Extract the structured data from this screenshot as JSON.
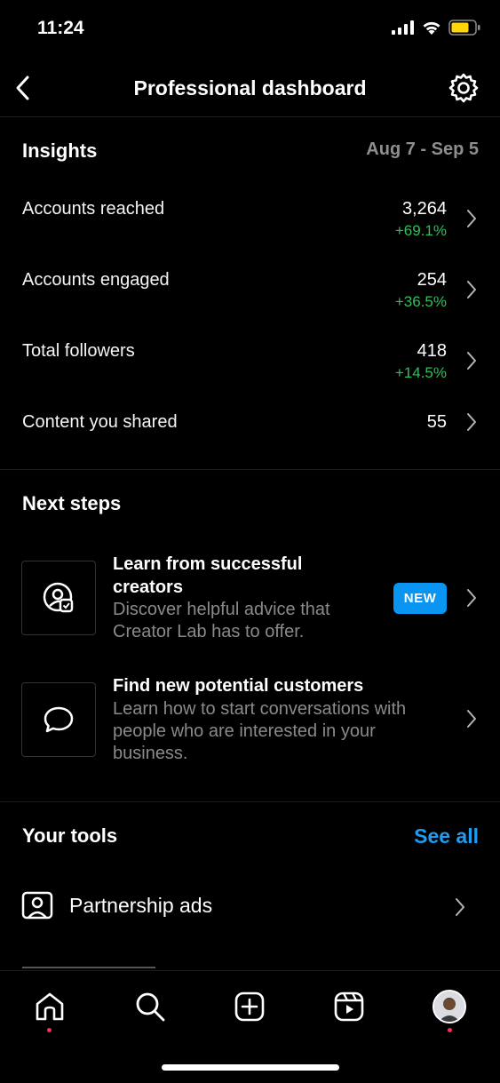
{
  "status_bar": {
    "time": "11:24"
  },
  "header": {
    "title": "Professional dashboard"
  },
  "insights": {
    "title": "Insights",
    "date_range": "Aug 7 - Sep 5",
    "rows": [
      {
        "label": "Accounts reached",
        "value": "3,264",
        "change": "+69.1%"
      },
      {
        "label": "Accounts engaged",
        "value": "254",
        "change": "+36.5%"
      },
      {
        "label": "Total followers",
        "value": "418",
        "change": "+14.5%"
      },
      {
        "label": "Content you shared",
        "value": "55",
        "change": ""
      }
    ]
  },
  "next_steps": {
    "title": "Next steps",
    "items": [
      {
        "title_line1": "Learn from successful",
        "title_line2": "creators",
        "desc_line1": "Discover helpful advice that",
        "desc_line2": "Creator Lab has to offer.",
        "badge": "NEW",
        "icon": "creator-lab-icon"
      },
      {
        "title_line1": "Find new potential customers",
        "desc_line1": "Learn how to start conversations with",
        "desc_line2": "people who are interested in your",
        "desc_line3": "business.",
        "icon": "chat-bubble-icon"
      }
    ]
  },
  "tools": {
    "title": "Your tools",
    "see_all": "See all",
    "items": [
      {
        "label": "Partnership ads",
        "icon": "partnership-ads-icon"
      }
    ]
  },
  "colors": {
    "positive_change": "#2fbf5d",
    "accent": "#1f9bf0",
    "badge": "#0a95f2",
    "notification_dot": "#ff2d55"
  }
}
